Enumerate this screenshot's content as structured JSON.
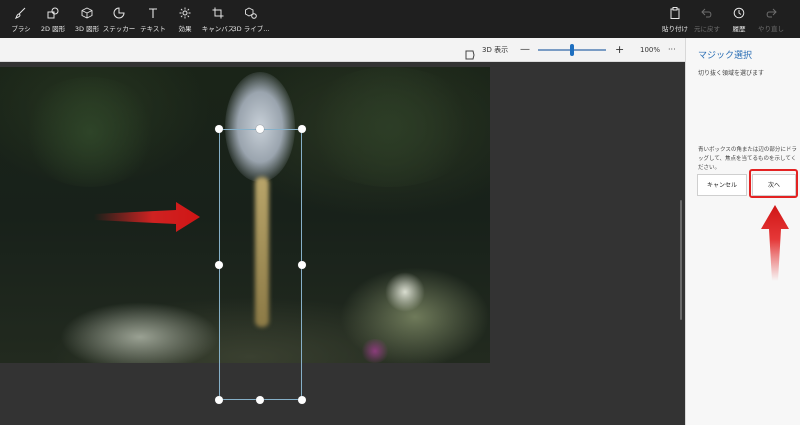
{
  "toolbar": {
    "tools": [
      {
        "label": "ブラシ",
        "icon": "brush-icon"
      },
      {
        "label": "2D 図形",
        "icon": "2d-shapes-icon"
      },
      {
        "label": "3D 図形",
        "icon": "3d-shapes-icon"
      },
      {
        "label": "ステッカー",
        "icon": "stickers-icon"
      },
      {
        "label": "テキスト",
        "icon": "text-icon"
      },
      {
        "label": "効果",
        "icon": "effects-icon"
      },
      {
        "label": "キャンバス",
        "icon": "canvas-icon"
      },
      {
        "label": "3D ライブ...",
        "icon": "3d-library-icon"
      }
    ],
    "right_tools": [
      {
        "label": "貼り付け",
        "icon": "paste-icon",
        "enabled": true
      },
      {
        "label": "元に戻す",
        "icon": "undo-icon",
        "enabled": false
      },
      {
        "label": "履歴",
        "icon": "history-icon",
        "enabled": true
      },
      {
        "label": "やり直し",
        "icon": "redo-icon",
        "enabled": false
      }
    ]
  },
  "subbar": {
    "view3d_label": "3D 表示",
    "zoom_minus": "—",
    "zoom_plus": "+",
    "zoom_level": 100,
    "zoom_text": "100%",
    "more": "···"
  },
  "panel": {
    "title": "マジック選択",
    "hint": "切り抜く領域を選びます",
    "description": "青いボックスの角または辺の部分にドラッグして、焦点を当てるものを示してください。",
    "cancel_label": "キャンセル",
    "next_label": "次へ"
  },
  "colors": {
    "accent": "#2c6fb5",
    "annotation_red": "#e32222",
    "toolbar_bg": "#1f1f1f",
    "canvas_bg": "#333333"
  }
}
